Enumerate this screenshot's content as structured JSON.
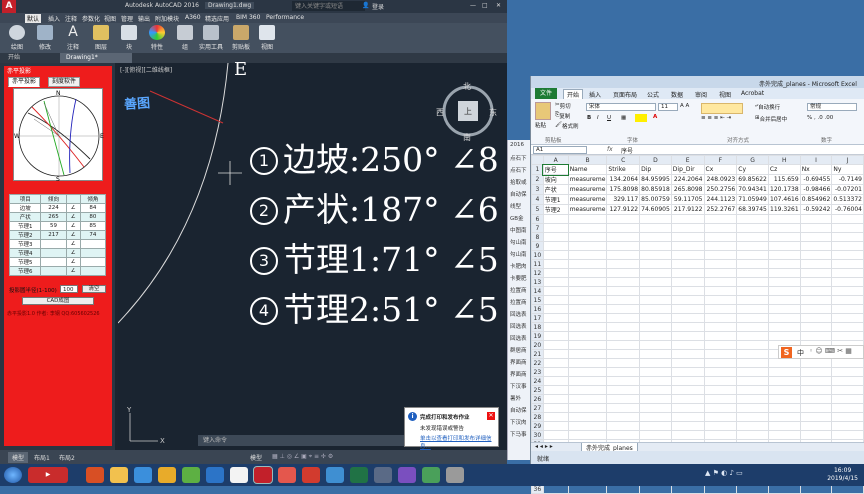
{
  "cad": {
    "logo": "A",
    "title": "Autodesk AutoCAD 2016",
    "file": "Drawing1.dwg",
    "search_placeholder": "键入关键字或短语",
    "login": "登录",
    "menu": [
      "默认",
      "插入",
      "注释",
      "参数化",
      "视图",
      "管理",
      "输出",
      "附加模块",
      "A360",
      "精选应用",
      "BIM 360",
      "Performance"
    ],
    "ribbon": [
      "绘图",
      "修改",
      "注释",
      "图层",
      "块",
      "特性",
      "组",
      "实用工具",
      "剪贴板",
      "视图"
    ],
    "doc_tabs": [
      "开始",
      "Drawing1*"
    ],
    "viewport_label": "[-][俯视][二维线框]",
    "axis_letter": "E",
    "cmd_placeholder": "键入命令",
    "status": [
      "模型",
      "布局1",
      "布局2"
    ],
    "status_model": "模型"
  },
  "stereonet": {
    "title": "赤平投影",
    "tabs": [
      "赤平投影",
      "刻度软件"
    ],
    "north": "N",
    "south": "S",
    "east": "E",
    "west": "W",
    "headers": [
      "项目",
      "倾向",
      "",
      "倾角"
    ],
    "rows": [
      {
        "name": "边坡",
        "dir": "224",
        "sym": "∠",
        "dip": "84"
      },
      {
        "name": "产状",
        "dir": "265",
        "sym": "∠",
        "dip": "80"
      },
      {
        "name": "节理1",
        "dir": "59",
        "sym": "∠",
        "dip": "85"
      },
      {
        "name": "节理2",
        "dir": "217",
        "sym": "∠",
        "dip": "74"
      },
      {
        "name": "节理3",
        "dir": "",
        "sym": "∠",
        "dip": ""
      },
      {
        "name": "节理4",
        "dir": "",
        "sym": "∠",
        "dip": ""
      },
      {
        "name": "节理5",
        "dir": "",
        "sym": "∠",
        "dip": ""
      },
      {
        "name": "节理6",
        "dir": "",
        "sym": "∠",
        "dip": ""
      }
    ],
    "radius_label": "投影圆半径(1-100)",
    "radius_value": "100",
    "clear_button": "清空",
    "cad_button": "CAD成图",
    "footer": "赤平投影1.0 作者: 李钢  QQ:605602526"
  },
  "drawing": {
    "lines": [
      {
        "n": "1",
        "text": "边坡:250° ∠8"
      },
      {
        "n": "2",
        "text": "产状:187° ∠6"
      },
      {
        "n": "3",
        "text": "节理1:71° ∠5"
      },
      {
        "n": "4",
        "text": "节理2:51° ∠5"
      }
    ],
    "watermark": "善图",
    "compass": {
      "n": "北",
      "s": "南",
      "e": "东",
      "w": "西",
      "center": "上"
    }
  },
  "notification": {
    "title": "完成打印和发布作业",
    "line1": "未发现错误或警告",
    "line2": "单击以查看打印和发布详细信息..."
  },
  "side_items": [
    "2016",
    "点石下",
    "点石下",
    "拾取或",
    "自动保",
    "线型",
    "GB金",
    "中图南",
    "勾山南",
    "勾山南",
    "卡肥肉",
    "卡要肥",
    "拉置商",
    "拉置商",
    "回选表",
    "回选表",
    "回选表",
    "群居商",
    "界面商",
    "界面商",
    "下汉事",
    "暑外",
    "自动保",
    "下汉肉",
    "下马事"
  ],
  "excel": {
    "title": "赤外完成_planes - Microsoft Excel",
    "tabs": [
      "文件",
      "开始",
      "插入",
      "页面布局",
      "公式",
      "数据",
      "审阅",
      "视图",
      "Acrobat"
    ],
    "ribbon": {
      "paste": "粘贴",
      "cut": "剪切",
      "copy": "复制",
      "format_painter": "格式刷",
      "clipboard": "剪贴板",
      "font": "宋体",
      "font_size": "11",
      "font_group": "字体",
      "align_group": "对齐方式",
      "wrap": "自动换行",
      "merge": "合并后居中",
      "number_format": "常规",
      "number_group": "数字"
    },
    "name_box": "A1",
    "formula": "序号",
    "col_headers": [
      "",
      "A",
      "B",
      "C",
      "D",
      "E",
      "F",
      "G",
      "H",
      "I",
      "J"
    ],
    "row_headers": [
      "1",
      "2",
      "3",
      "4",
      "5",
      "6",
      "7",
      "8",
      "9",
      "10",
      "11",
      "12",
      "13",
      "14",
      "15",
      "16",
      "17",
      "18",
      "19",
      "20",
      "21",
      "22",
      "23",
      "24",
      "25",
      "26",
      "27",
      "28",
      "29",
      "30",
      "31",
      "32",
      "33",
      "34",
      "35",
      "36"
    ],
    "rows": [
      [
        "序号",
        "Name",
        "Strike",
        "Dip",
        "Dip_Dir",
        "Cx",
        "Cy",
        "Cz",
        "Nx",
        "Ny"
      ],
      [
        "坡向",
        "measureme",
        "134.2064",
        "84.95995",
        "224.2064",
        "248.0923",
        "69.85622",
        "115.659",
        "-0.69455",
        "-0.7149"
      ],
      [
        "产状",
        "measureme",
        "175.8098",
        "80.85918",
        "265.8098",
        "250.2756",
        "70.94341",
        "120.1738",
        "-0.98466",
        "-0.07201"
      ],
      [
        "节理1",
        "measureme",
        "329.117",
        "85.00759",
        "59.11705",
        "244.1123",
        "71.05949",
        "107.4616",
        "0.854962",
        "0.513372"
      ],
      [
        "节理2",
        "measureme",
        "127.9122",
        "74.60905",
        "217.9122",
        "252.2767",
        "68.39745",
        "119.3261",
        "-0.59242",
        "-0.76004"
      ]
    ],
    "sheet_tab": "赤外完成_planes",
    "status_ready": "就绪"
  },
  "ime": {
    "logo": "S",
    "label": "中"
  },
  "taskbar": {
    "time": "16:09",
    "date": "2019/4/15"
  }
}
